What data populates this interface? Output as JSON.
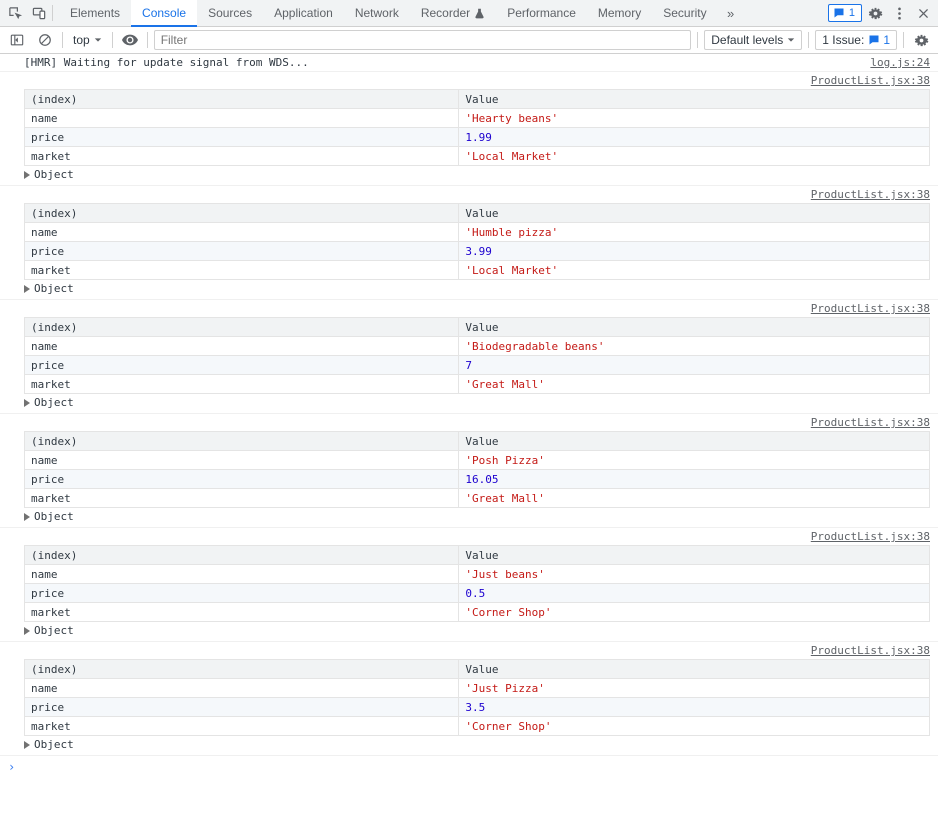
{
  "tabs": {
    "items": [
      "Elements",
      "Console",
      "Sources",
      "Application",
      "Network",
      "Recorder",
      "Performance",
      "Memory",
      "Security"
    ],
    "active_index": 1,
    "overflow_glyph": "»",
    "issues_count": "1"
  },
  "toolbar": {
    "context": "top",
    "filter_placeholder": "Filter",
    "levels_label": "Default levels",
    "issues_label": "1 Issue:",
    "issues_count": "1"
  },
  "first_log": {
    "message": "[HMR] Waiting for update signal from WDS...",
    "source": "log.js:24"
  },
  "group_source": "ProductList.jsx:38",
  "headers": {
    "index": "(index)",
    "value": "Value"
  },
  "row_keys": {
    "name": "name",
    "price": "price",
    "market": "market"
  },
  "object_label": "Object",
  "tables": [
    {
      "name": "'Hearty beans'",
      "price": "1.99",
      "market": "'Local Market'"
    },
    {
      "name": "'Humble pizza'",
      "price": "3.99",
      "market": "'Local Market'"
    },
    {
      "name": "'Biodegradable beans'",
      "price": "7",
      "market": "'Great Mall'"
    },
    {
      "name": "'Posh Pizza'",
      "price": "16.05",
      "market": "'Great Mall'"
    },
    {
      "name": "'Just beans'",
      "price": "0.5",
      "market": "'Corner Shop'"
    },
    {
      "name": "'Just Pizza'",
      "price": "3.5",
      "market": "'Corner Shop'"
    }
  ],
  "prompt_glyph": "›"
}
